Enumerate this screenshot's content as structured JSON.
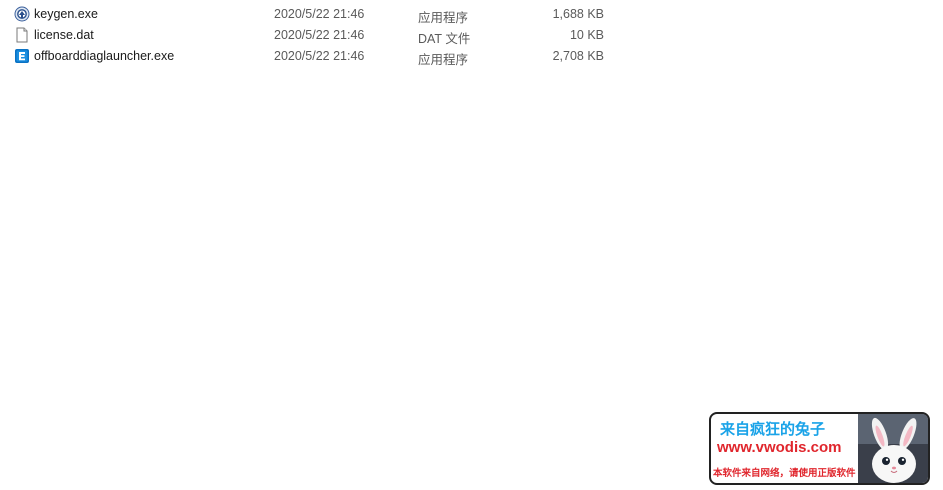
{
  "files": [
    {
      "name": "keygen.exe",
      "modified": "2020/5/22 21:46",
      "type": "应用程序",
      "size": "1,688 KB",
      "icon": "keygen-app-icon"
    },
    {
      "name": "license.dat",
      "modified": "2020/5/22 21:46",
      "type": "DAT 文件",
      "size": "10 KB",
      "icon": "blank-document-icon"
    },
    {
      "name": "offboarddiaglauncher.exe",
      "modified": "2020/5/22 21:46",
      "type": "应用程序",
      "size": "2,708 KB",
      "icon": "launcher-app-icon"
    }
  ],
  "watermark": {
    "title": "来自疯狂的兔子",
    "url": "www.vwodis.com",
    "note": "本软件来自网络，请使用正版软件",
    "title_color": "#1aa3e8",
    "text_color": "#e0262d"
  }
}
